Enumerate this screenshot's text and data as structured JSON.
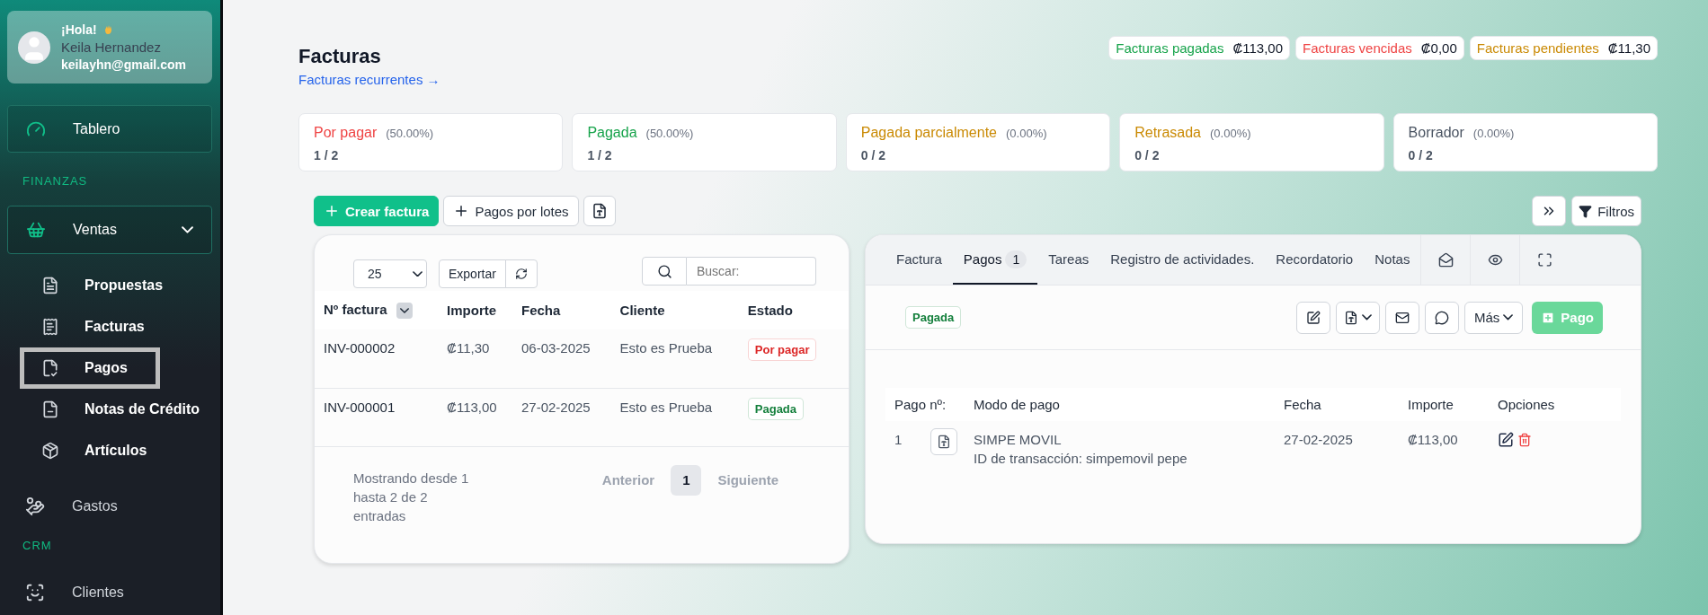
{
  "user": {
    "greeting": "¡Hola!",
    "name": "Keila Hernandez",
    "email": "keilayhn@gmail.com"
  },
  "sidebar": [
    {
      "kind": "card",
      "label": "Tablero",
      "selected": false
    },
    {
      "kind": "heading",
      "label": "FINANZAS"
    },
    {
      "kind": "group",
      "label": "Ventas",
      "expanded": true,
      "children": [
        {
          "label": "Propuestas",
          "selected": false
        },
        {
          "label": "Facturas",
          "selected": false
        },
        {
          "label": "Pagos",
          "selected": true
        },
        {
          "label": "Notas de Crédito",
          "selected": false
        },
        {
          "label": "Artículos",
          "selected": false
        }
      ]
    },
    {
      "kind": "link",
      "label": "Gastos",
      "selected": false
    },
    {
      "kind": "heading",
      "label": "CRM"
    },
    {
      "kind": "link",
      "label": "Clientes",
      "selected": false
    }
  ],
  "page": {
    "title": "Facturas",
    "link": "Facturas recurrentes →"
  },
  "totals": [
    {
      "label": "Facturas pagadas",
      "amount": "₡113,00",
      "color": "#16a34a"
    },
    {
      "label": "Facturas vencidas",
      "amount": "₡0,00",
      "color": "#ef4444"
    },
    {
      "label": "Facturas pendientes",
      "amount": "₡11,30",
      "color": "#ca8a04"
    }
  ],
  "status_cards": [
    {
      "label": "Por pagar",
      "percent": "(50.00%)",
      "count": "1 / 2",
      "color": "#ef4444"
    },
    {
      "label": "Pagada",
      "percent": "(50.00%)",
      "count": "1 / 2",
      "color": "#16a34a"
    },
    {
      "label": "Pagada parcialmente",
      "percent": "(0.00%)",
      "count": "0 / 2",
      "color": "#ca8a04"
    },
    {
      "label": "Retrasada",
      "percent": "(0.00%)",
      "count": "0 / 2",
      "color": "#ca8a04"
    },
    {
      "label": "Borrador",
      "percent": "(0.00%)",
      "count": "0 / 2",
      "color": "#4b5563"
    }
  ],
  "toolbar": {
    "create": "Crear factura",
    "batch": "Pagos por lotes",
    "filters": "Filtros"
  },
  "table": {
    "page_size": "25",
    "export": "Exportar",
    "search_placeholder": "Buscar:",
    "columns": [
      "Nº factura",
      "Importe",
      "Fecha",
      "Cliente",
      "Estado"
    ],
    "rows": [
      {
        "cells": [
          "INV-000002",
          "₡11,30",
          "06-03-2025",
          "Esto es Prueba"
        ],
        "status": "Por pagar",
        "color": "#dc2626"
      },
      {
        "cells": [
          "INV-000001",
          "₡113,00",
          "27-02-2025",
          "Esto es Prueba"
        ],
        "status": "Pagada",
        "color": "#15803d"
      }
    ],
    "info": "Mostrando desde 1 hasta 2 de 2 entradas",
    "pagination": {
      "previous": "Anterior",
      "pages": [
        {
          "label": "1",
          "selected": true
        }
      ],
      "next": "Siguiente"
    }
  },
  "detail": {
    "tabs": [
      {
        "label": "Factura",
        "selected": false
      },
      {
        "label": "Pagos",
        "badge": "1",
        "selected": true
      },
      {
        "label": "Tareas",
        "selected": false
      },
      {
        "label": "Registro de actividades.",
        "selected": false
      },
      {
        "label": "Recordatorio",
        "selected": false
      },
      {
        "label": "Notas",
        "selected": false
      }
    ],
    "status": "Pagada",
    "more": "Más",
    "add_payment": "Pago",
    "columns": [
      "Pago nº:",
      "Modo de pago",
      "Fecha",
      "Importe",
      "Opciones"
    ],
    "payments": [
      {
        "number": "1",
        "mode": "SIMPE MOVIL",
        "transaction": "ID de transacción: simpemovil pepe",
        "date": "27-02-2025",
        "amount": "₡113,00"
      }
    ]
  }
}
